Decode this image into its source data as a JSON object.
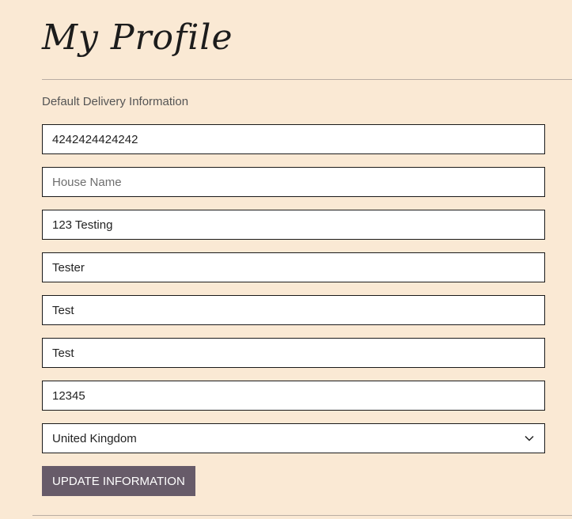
{
  "page": {
    "title": "My Profile"
  },
  "form": {
    "section_label": "Default Delivery Information",
    "fields": [
      {
        "value": "4242424424242",
        "placeholder": ""
      },
      {
        "value": "",
        "placeholder": "House Name"
      },
      {
        "value": "123 Testing",
        "placeholder": ""
      },
      {
        "value": "Tester",
        "placeholder": ""
      },
      {
        "value": "Test",
        "placeholder": ""
      },
      {
        "value": "Test",
        "placeholder": ""
      },
      {
        "value": "12345",
        "placeholder": ""
      }
    ],
    "country": "United Kingdom",
    "submit_label": "UPDATE INFORMATION"
  },
  "colors": {
    "background": "#fae9d4",
    "button": "#675b69",
    "border": "#1a1a1a"
  },
  "icons": {
    "select": "chevron-down-icon"
  }
}
